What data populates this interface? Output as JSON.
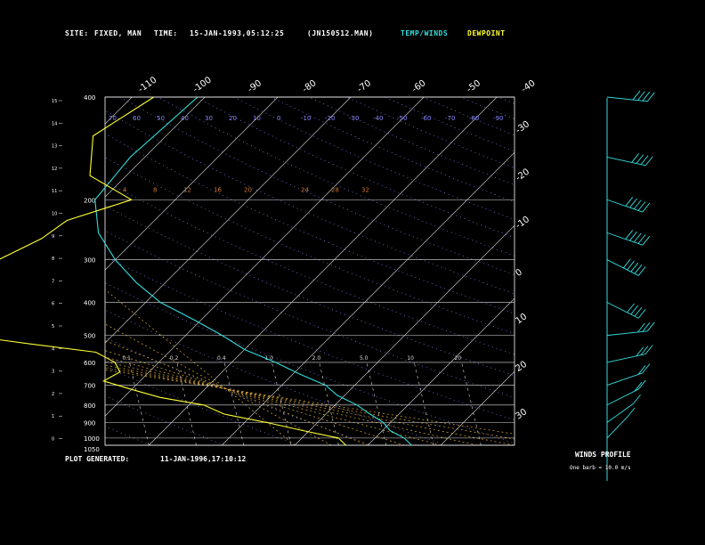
{
  "header": {
    "site_label": "SITE:",
    "site_value": "FIXED, MAN",
    "time_label": "TIME:",
    "time_value": "15-JAN-1993,05:12:25",
    "file_name": "(JN150512.MAN)",
    "legend_temp": "TEMP/WINDS",
    "legend_dew": "DEWPOINT"
  },
  "footer": {
    "generated_label": "PLOT GENERATED:",
    "generated_value": "11-JAN-1996,17:10:12"
  },
  "winds_profile": {
    "title": "WINDS PROFILE",
    "note": "One barb = 10.0 m/s"
  },
  "colors": {
    "temperature": "#33dddd",
    "dewpoint": "#ffff33",
    "isotherm": "#dddddd",
    "mixing_ratio": "#cc7733",
    "dry_adiabat": "#8888ff",
    "wet_adiabat": "#ddaa33",
    "barbs": "#33dddd"
  },
  "chart_data": {
    "type": "line",
    "subtype": "skew-T log-P sounding",
    "pressure_ticks": [
      "400",
      "200",
      "300",
      "400",
      "500",
      "600",
      "700",
      "800",
      "900",
      "1000",
      "1050"
    ],
    "pressure_levels": [
      100,
      200,
      300,
      400,
      500,
      600,
      700,
      800,
      900,
      1000,
      1050
    ],
    "height_ticks_km": [
      "15",
      "14",
      "13",
      "12",
      "11",
      "10",
      "9",
      "8",
      "7",
      "6",
      "5",
      "4",
      "3",
      "2",
      "1",
      "0"
    ],
    "top_temp_ticks": [
      "-110",
      "-100",
      "-90",
      "-80",
      "-70",
      "-60",
      "-50",
      "-40"
    ],
    "right_temp_ticks": [
      "-30",
      "-20",
      "-10",
      "0",
      "10",
      "20",
      "30"
    ],
    "dry_adiabat_labels": [
      "70",
      "60",
      "50",
      "40",
      "30",
      "20",
      "10",
      "0",
      "-10",
      "-20",
      "-30",
      "-40",
      "-50",
      "-60",
      "-70",
      "-80",
      "-90"
    ],
    "mixing_ratio_labels": [
      "0.1",
      "0.2",
      "0.4",
      "1.0",
      "2.0",
      "5.0",
      "10",
      "20"
    ],
    "series": [
      {
        "name": "TEMP/WINDS",
        "pressure_hpa": [
          100,
          150,
          200,
          250,
          300,
          350,
          400,
          450,
          500,
          550,
          600,
          650,
          700,
          750,
          800,
          850,
          900,
          950,
          1000,
          1050
        ],
        "temperature_c": [
          -71,
          -72,
          -71,
          -66,
          -60,
          -54,
          -48,
          -41,
          -35,
          -30,
          -24,
          -19,
          -14,
          -11,
          -7,
          -4,
          -1,
          1,
          4,
          6
        ]
      },
      {
        "name": "DEWPOINT",
        "pressure_hpa": [
          100,
          130,
          170,
          200,
          230,
          260,
          300,
          340,
          380,
          420,
          450,
          480,
          500,
          530,
          560,
          600,
          640,
          680,
          720,
          760,
          800,
          850,
          900,
          950,
          1000,
          1050
        ],
        "dewpoint_c": [
          -77,
          -80,
          -75,
          -66,
          -72,
          -73,
          -76,
          -80,
          -84,
          -82,
          -80,
          -72,
          -70,
          -60,
          -50,
          -46,
          -44,
          -45,
          -40,
          -35,
          -28,
          -24,
          -17,
          -11,
          -5,
          -3
        ]
      }
    ],
    "winds": [
      {
        "pressure_hpa": 100,
        "dir_deg": 260,
        "speed_ms": 35
      },
      {
        "pressure_hpa": 150,
        "dir_deg": 250,
        "speed_ms": 40
      },
      {
        "pressure_hpa": 200,
        "dir_deg": 240,
        "speed_ms": 45
      },
      {
        "pressure_hpa": 250,
        "dir_deg": 240,
        "speed_ms": 50
      },
      {
        "pressure_hpa": 300,
        "dir_deg": 230,
        "speed_ms": 45
      },
      {
        "pressure_hpa": 400,
        "dir_deg": 230,
        "speed_ms": 40
      },
      {
        "pressure_hpa": 500,
        "dir_deg": 280,
        "speed_ms": 30
      },
      {
        "pressure_hpa": 600,
        "dir_deg": 290,
        "speed_ms": 25
      },
      {
        "pressure_hpa": 700,
        "dir_deg": 300,
        "speed_ms": 20
      },
      {
        "pressure_hpa": 800,
        "dir_deg": 310,
        "speed_ms": 15
      },
      {
        "pressure_hpa": 900,
        "dir_deg": 320,
        "speed_ms": 10
      },
      {
        "pressure_hpa": 1000,
        "dir_deg": 330,
        "speed_ms": 10
      }
    ],
    "xlim": [
      -40,
      40
    ],
    "ylim": [
      1050,
      100
    ],
    "yscale": "log",
    "grid": true
  }
}
